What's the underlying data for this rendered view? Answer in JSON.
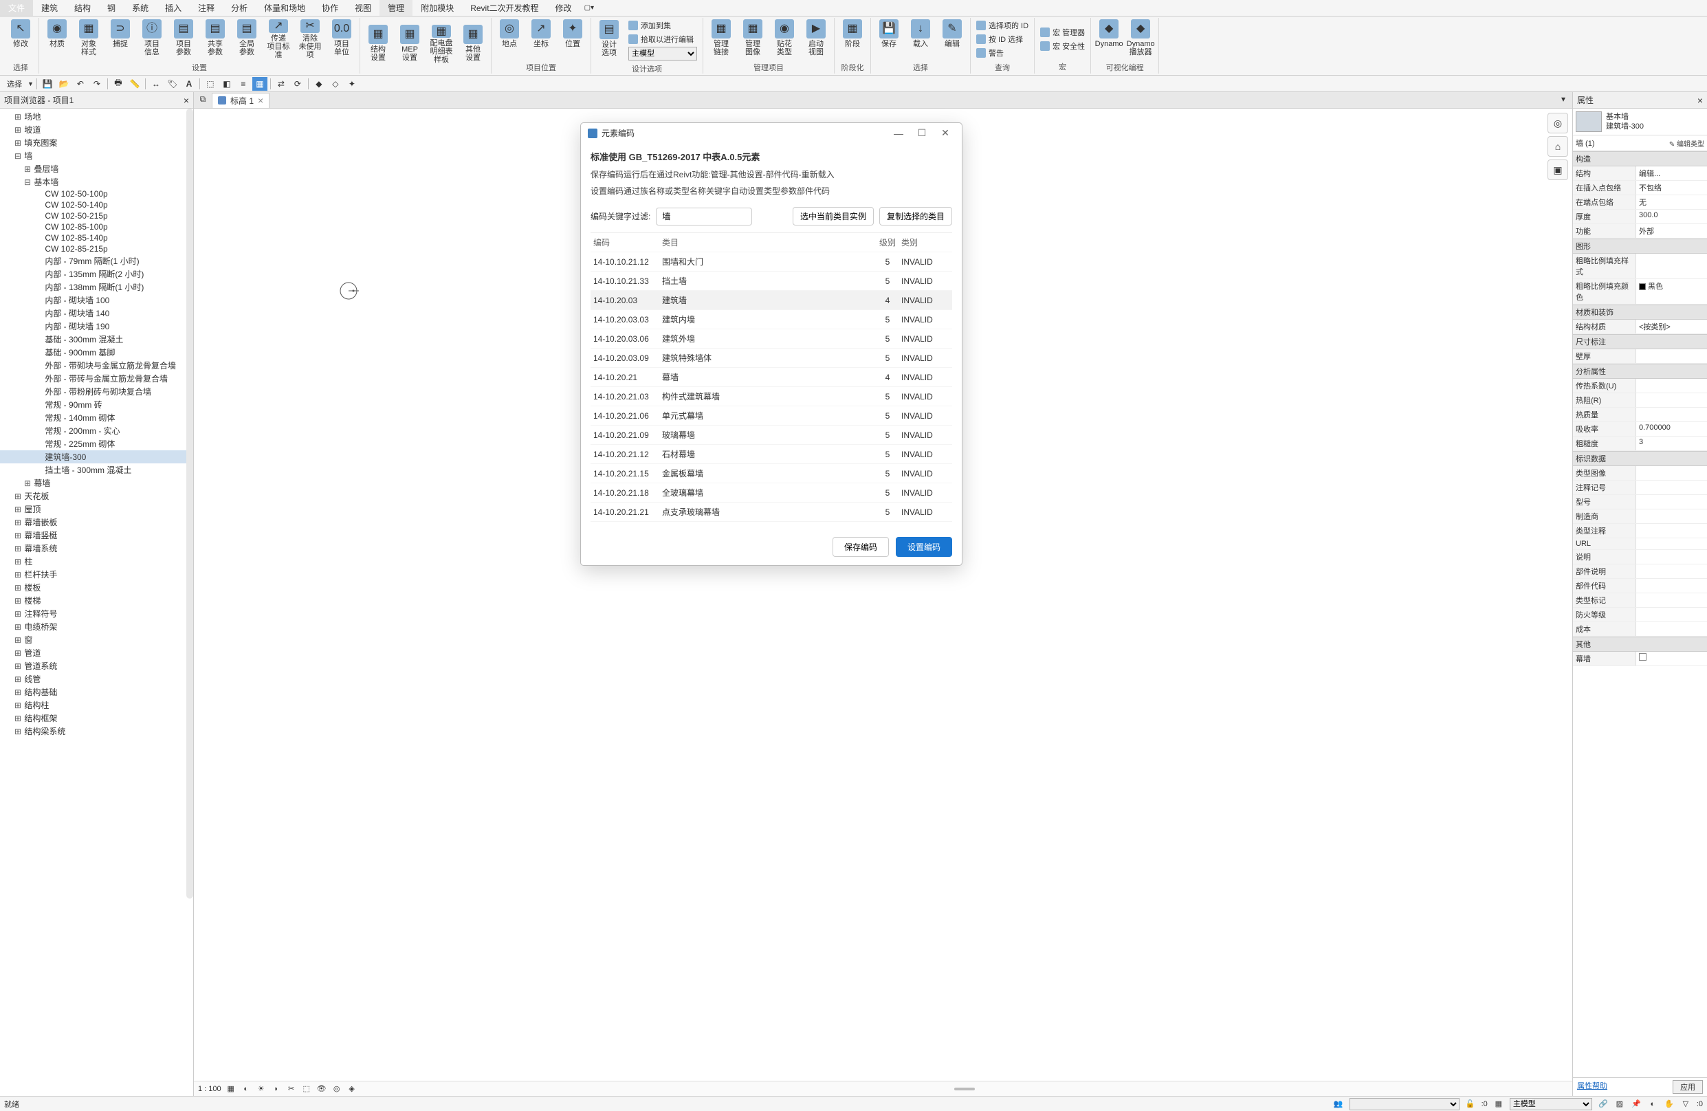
{
  "menu": {
    "items": [
      "文件",
      "建筑",
      "结构",
      "钢",
      "系统",
      "插入",
      "注释",
      "分析",
      "体量和场地",
      "协作",
      "视图",
      "管理",
      "附加模块",
      "Revit二次开发教程",
      "修改"
    ],
    "activeIndex": 11
  },
  "ribbon": {
    "groups": [
      {
        "label": "选择",
        "items": [
          {
            "label": "修改",
            "ico": "↖"
          }
        ]
      },
      {
        "label": "",
        "items": [
          {
            "label": "材质",
            "ico": "◉"
          },
          {
            "label": "对象\n样式",
            "ico": "▦"
          },
          {
            "label": "捕捉",
            "ico": "⊃"
          },
          {
            "label": "项目\n信息",
            "ico": "ⓘ"
          },
          {
            "label": "项目\n参数",
            "ico": "▤"
          },
          {
            "label": "共享\n参数",
            "ico": "▤"
          },
          {
            "label": "全局\n参数",
            "ico": "▤"
          },
          {
            "label": "传递\n项目标准",
            "ico": "↗"
          },
          {
            "label": "清除\n未使用项",
            "ico": "✂"
          },
          {
            "label": "项目\n单位",
            "ico": "0.0"
          }
        ],
        "groupLabel": "设置"
      },
      {
        "label": "",
        "items": [
          {
            "label": "结构\n设置",
            "ico": "▦"
          },
          {
            "label": "MEP\n设置",
            "ico": "▦"
          },
          {
            "label": "配电盘明细表\n样板",
            "ico": "▦"
          },
          {
            "label": "其他\n设置",
            "ico": "▦"
          }
        ]
      },
      {
        "label": "项目位置",
        "items": [
          {
            "label": "地点",
            "ico": "◎"
          },
          {
            "label": "坐标",
            "ico": "↗"
          },
          {
            "label": "位置",
            "ico": "✦"
          }
        ]
      },
      {
        "label": "设计选项",
        "items": [
          {
            "label": "设计\n选项",
            "ico": "▤"
          }
        ],
        "vlist": [
          {
            "label": "添加到集"
          },
          {
            "label": "拾取以进行编辑"
          }
        ],
        "select": "主模型"
      },
      {
        "label": "管理项目",
        "items": [
          {
            "label": "管理\n链接",
            "ico": "▦"
          },
          {
            "label": "管理\n图像",
            "ico": "▦"
          },
          {
            "label": "贴花\n类型",
            "ico": "◉"
          },
          {
            "label": "启动\n视图",
            "ico": "▶"
          }
        ]
      },
      {
        "label": "阶段化",
        "items": [
          {
            "label": "阶段",
            "ico": "▦"
          }
        ]
      },
      {
        "label": "选择",
        "items": [
          {
            "label": "保存",
            "ico": "💾"
          },
          {
            "label": "载入",
            "ico": "↓"
          },
          {
            "label": "编辑",
            "ico": "✎"
          }
        ]
      },
      {
        "label": "查询",
        "vlist": [
          {
            "label": "选择项的 ID"
          },
          {
            "label": "按 ID 选择"
          },
          {
            "label": "警告"
          }
        ]
      },
      {
        "label": "宏",
        "vlist": [
          {
            "label": "宏 管理器"
          },
          {
            "label": "宏 安全性"
          }
        ]
      },
      {
        "label": "可视化编程",
        "items": [
          {
            "label": "Dynamo",
            "ico": "◆"
          },
          {
            "label": "Dynamo\n播放器",
            "ico": "◆"
          }
        ]
      }
    ]
  },
  "qat": {
    "select_label": "选择"
  },
  "browser": {
    "title": "项目浏览器 - 项目1",
    "nodes": [
      {
        "d": 0,
        "exp": "⊞",
        "label": "场地"
      },
      {
        "d": 0,
        "exp": "⊞",
        "label": "坡道"
      },
      {
        "d": 0,
        "exp": "⊞",
        "label": "填充图案"
      },
      {
        "d": 0,
        "exp": "⊟",
        "label": "墙"
      },
      {
        "d": 1,
        "exp": "⊞",
        "label": "叠层墙"
      },
      {
        "d": 1,
        "exp": "⊟",
        "label": "基本墙"
      },
      {
        "d": 2,
        "exp": "",
        "label": "CW 102-50-100p"
      },
      {
        "d": 2,
        "exp": "",
        "label": "CW 102-50-140p"
      },
      {
        "d": 2,
        "exp": "",
        "label": "CW 102-50-215p"
      },
      {
        "d": 2,
        "exp": "",
        "label": "CW 102-85-100p"
      },
      {
        "d": 2,
        "exp": "",
        "label": "CW 102-85-140p"
      },
      {
        "d": 2,
        "exp": "",
        "label": "CW 102-85-215p"
      },
      {
        "d": 2,
        "exp": "",
        "label": "内部 - 79mm 隔断(1 小时)"
      },
      {
        "d": 2,
        "exp": "",
        "label": "内部 - 135mm 隔断(2 小时)"
      },
      {
        "d": 2,
        "exp": "",
        "label": "内部 - 138mm 隔断(1 小时)"
      },
      {
        "d": 2,
        "exp": "",
        "label": "内部 - 砌块墙 100"
      },
      {
        "d": 2,
        "exp": "",
        "label": "内部 - 砌块墙 140"
      },
      {
        "d": 2,
        "exp": "",
        "label": "内部 - 砌块墙 190"
      },
      {
        "d": 2,
        "exp": "",
        "label": "基础 - 300mm 混凝土"
      },
      {
        "d": 2,
        "exp": "",
        "label": "基础 - 900mm 基脚"
      },
      {
        "d": 2,
        "exp": "",
        "label": "外部 - 带砌块与金属立筋龙骨复合墙"
      },
      {
        "d": 2,
        "exp": "",
        "label": "外部 - 带砖与金属立筋龙骨复合墙"
      },
      {
        "d": 2,
        "exp": "",
        "label": "外部 - 带粉刷砖与砌块复合墙"
      },
      {
        "d": 2,
        "exp": "",
        "label": "常规 - 90mm 砖"
      },
      {
        "d": 2,
        "exp": "",
        "label": "常规 - 140mm 砌体"
      },
      {
        "d": 2,
        "exp": "",
        "label": "常规 - 200mm - 实心"
      },
      {
        "d": 2,
        "exp": "",
        "label": "常规 - 225mm 砌体"
      },
      {
        "d": 2,
        "exp": "",
        "label": "建筑墙-300",
        "selected": true
      },
      {
        "d": 2,
        "exp": "",
        "label": "挡土墙 - 300mm 混凝土"
      },
      {
        "d": 1,
        "exp": "⊞",
        "label": "幕墙"
      },
      {
        "d": 0,
        "exp": "⊞",
        "label": "天花板"
      },
      {
        "d": 0,
        "exp": "⊞",
        "label": "屋顶"
      },
      {
        "d": 0,
        "exp": "⊞",
        "label": "幕墙嵌板"
      },
      {
        "d": 0,
        "exp": "⊞",
        "label": "幕墙竖梃"
      },
      {
        "d": 0,
        "exp": "⊞",
        "label": "幕墙系统"
      },
      {
        "d": 0,
        "exp": "⊞",
        "label": "柱"
      },
      {
        "d": 0,
        "exp": "⊞",
        "label": "栏杆扶手"
      },
      {
        "d": 0,
        "exp": "⊞",
        "label": "楼板"
      },
      {
        "d": 0,
        "exp": "⊞",
        "label": "楼梯"
      },
      {
        "d": 0,
        "exp": "⊞",
        "label": "注释符号"
      },
      {
        "d": 0,
        "exp": "⊞",
        "label": "电缆桥架"
      },
      {
        "d": 0,
        "exp": "⊞",
        "label": "窗"
      },
      {
        "d": 0,
        "exp": "⊞",
        "label": "管道"
      },
      {
        "d": 0,
        "exp": "⊞",
        "label": "管道系统"
      },
      {
        "d": 0,
        "exp": "⊞",
        "label": "线管"
      },
      {
        "d": 0,
        "exp": "⊞",
        "label": "结构基础"
      },
      {
        "d": 0,
        "exp": "⊞",
        "label": "结构柱"
      },
      {
        "d": 0,
        "exp": "⊞",
        "label": "结构框架"
      },
      {
        "d": 0,
        "exp": "⊞",
        "label": "结构梁系统"
      }
    ]
  },
  "tab": {
    "name": "标高 1"
  },
  "scale": "1 : 100",
  "dialog": {
    "title": "元素编码",
    "heading": "标准使用 GB_T51269-2017 中表A.0.5元素",
    "desc1": "保存编码运行后在通过Reivt功能:管理-其他设置-部件代码-重新载入",
    "desc2": "设置编码通过族名称或类型名称关键字自动设置类型参数部件代码",
    "filter_label": "编码关键字过滤:",
    "filter_value": "墙",
    "btn_sel": "选中当前类目实例",
    "btn_copy": "复制选择的类目",
    "th": {
      "c1": "编码",
      "c2": "类目",
      "c3": "级别",
      "c4": "类别"
    },
    "rows": [
      {
        "c1": "14-10.10.21.12",
        "c2": "围墙和大门",
        "c3": "5",
        "c4": "INVALID"
      },
      {
        "c1": "14-10.10.21.33",
        "c2": "挡土墙",
        "c3": "5",
        "c4": "INVALID"
      },
      {
        "c1": "14-10.20.03",
        "c2": "建筑墙",
        "c3": "4",
        "c4": "INVALID",
        "sel": true
      },
      {
        "c1": "14-10.20.03.03",
        "c2": "建筑内墙",
        "c3": "5",
        "c4": "INVALID"
      },
      {
        "c1": "14-10.20.03.06",
        "c2": "建筑外墙",
        "c3": "5",
        "c4": "INVALID"
      },
      {
        "c1": "14-10.20.03.09",
        "c2": "建筑特殊墙体",
        "c3": "5",
        "c4": "INVALID"
      },
      {
        "c1": "14-10.20.21",
        "c2": "幕墙",
        "c3": "4",
        "c4": "INVALID"
      },
      {
        "c1": "14-10.20.21.03",
        "c2": "构件式建筑幕墙",
        "c3": "5",
        "c4": "INVALID"
      },
      {
        "c1": "14-10.20.21.06",
        "c2": "单元式幕墙",
        "c3": "5",
        "c4": "INVALID"
      },
      {
        "c1": "14-10.20.21.09",
        "c2": "玻璃幕墙",
        "c3": "5",
        "c4": "INVALID"
      },
      {
        "c1": "14-10.20.21.12",
        "c2": "石材幕墙",
        "c3": "5",
        "c4": "INVALID"
      },
      {
        "c1": "14-10.20.21.15",
        "c2": "金属板幕墙",
        "c3": "5",
        "c4": "INVALID"
      },
      {
        "c1": "14-10.20.21.18",
        "c2": "全玻璃幕墙",
        "c3": "5",
        "c4": "INVALID"
      },
      {
        "c1": "14-10.20.21.21",
        "c2": "点支承玻璃幕墙",
        "c3": "5",
        "c4": "INVALID"
      }
    ],
    "save": "保存编码",
    "set": "设置编码"
  },
  "props": {
    "title": "属性",
    "type_l1": "基本墙",
    "type_l2": "建筑墙-300",
    "sel": "墙 (1)",
    "edit": "✎ 编辑类型",
    "groups": [
      {
        "h": "构造",
        "rows": [
          {
            "k": "结构",
            "v": "编辑..."
          },
          {
            "k": "在插入点包络",
            "v": "不包络"
          },
          {
            "k": "在端点包络",
            "v": "无"
          },
          {
            "k": "厚度",
            "v": "300.0"
          },
          {
            "k": "功能",
            "v": "外部"
          }
        ]
      },
      {
        "h": "图形",
        "rows": [
          {
            "k": "粗略比例填充样式",
            "v": ""
          },
          {
            "k": "粗略比例填充颜色",
            "v": "黑色",
            "swatch": true
          }
        ]
      },
      {
        "h": "材质和装饰",
        "rows": [
          {
            "k": "结构材质",
            "v": "<按类别>"
          }
        ]
      },
      {
        "h": "尺寸标注",
        "rows": [
          {
            "k": "壁厚",
            "v": ""
          }
        ]
      },
      {
        "h": "分析属性",
        "rows": [
          {
            "k": "传热系数(U)",
            "v": ""
          },
          {
            "k": "热阻(R)",
            "v": ""
          },
          {
            "k": "热质量",
            "v": ""
          },
          {
            "k": "吸收率",
            "v": "0.700000"
          },
          {
            "k": "粗糙度",
            "v": "3"
          }
        ]
      },
      {
        "h": "标识数据",
        "rows": [
          {
            "k": "类型图像",
            "v": ""
          },
          {
            "k": "注释记号",
            "v": ""
          },
          {
            "k": "型号",
            "v": ""
          },
          {
            "k": "制造商",
            "v": ""
          },
          {
            "k": "类型注释",
            "v": ""
          },
          {
            "k": "URL",
            "v": ""
          },
          {
            "k": "说明",
            "v": ""
          },
          {
            "k": "部件说明",
            "v": ""
          },
          {
            "k": "部件代码",
            "v": ""
          },
          {
            "k": "类型标记",
            "v": ""
          },
          {
            "k": "防火等级",
            "v": ""
          },
          {
            "k": "成本",
            "v": ""
          }
        ]
      },
      {
        "h": "其他",
        "rows": [
          {
            "k": "幕墙",
            "v": "",
            "checkbox": true
          }
        ]
      }
    ],
    "help": "属性帮助",
    "apply": "应用"
  },
  "status": {
    "ready": "就绪",
    "count1": ":0",
    "count2": ":0",
    "model": "主模型"
  }
}
